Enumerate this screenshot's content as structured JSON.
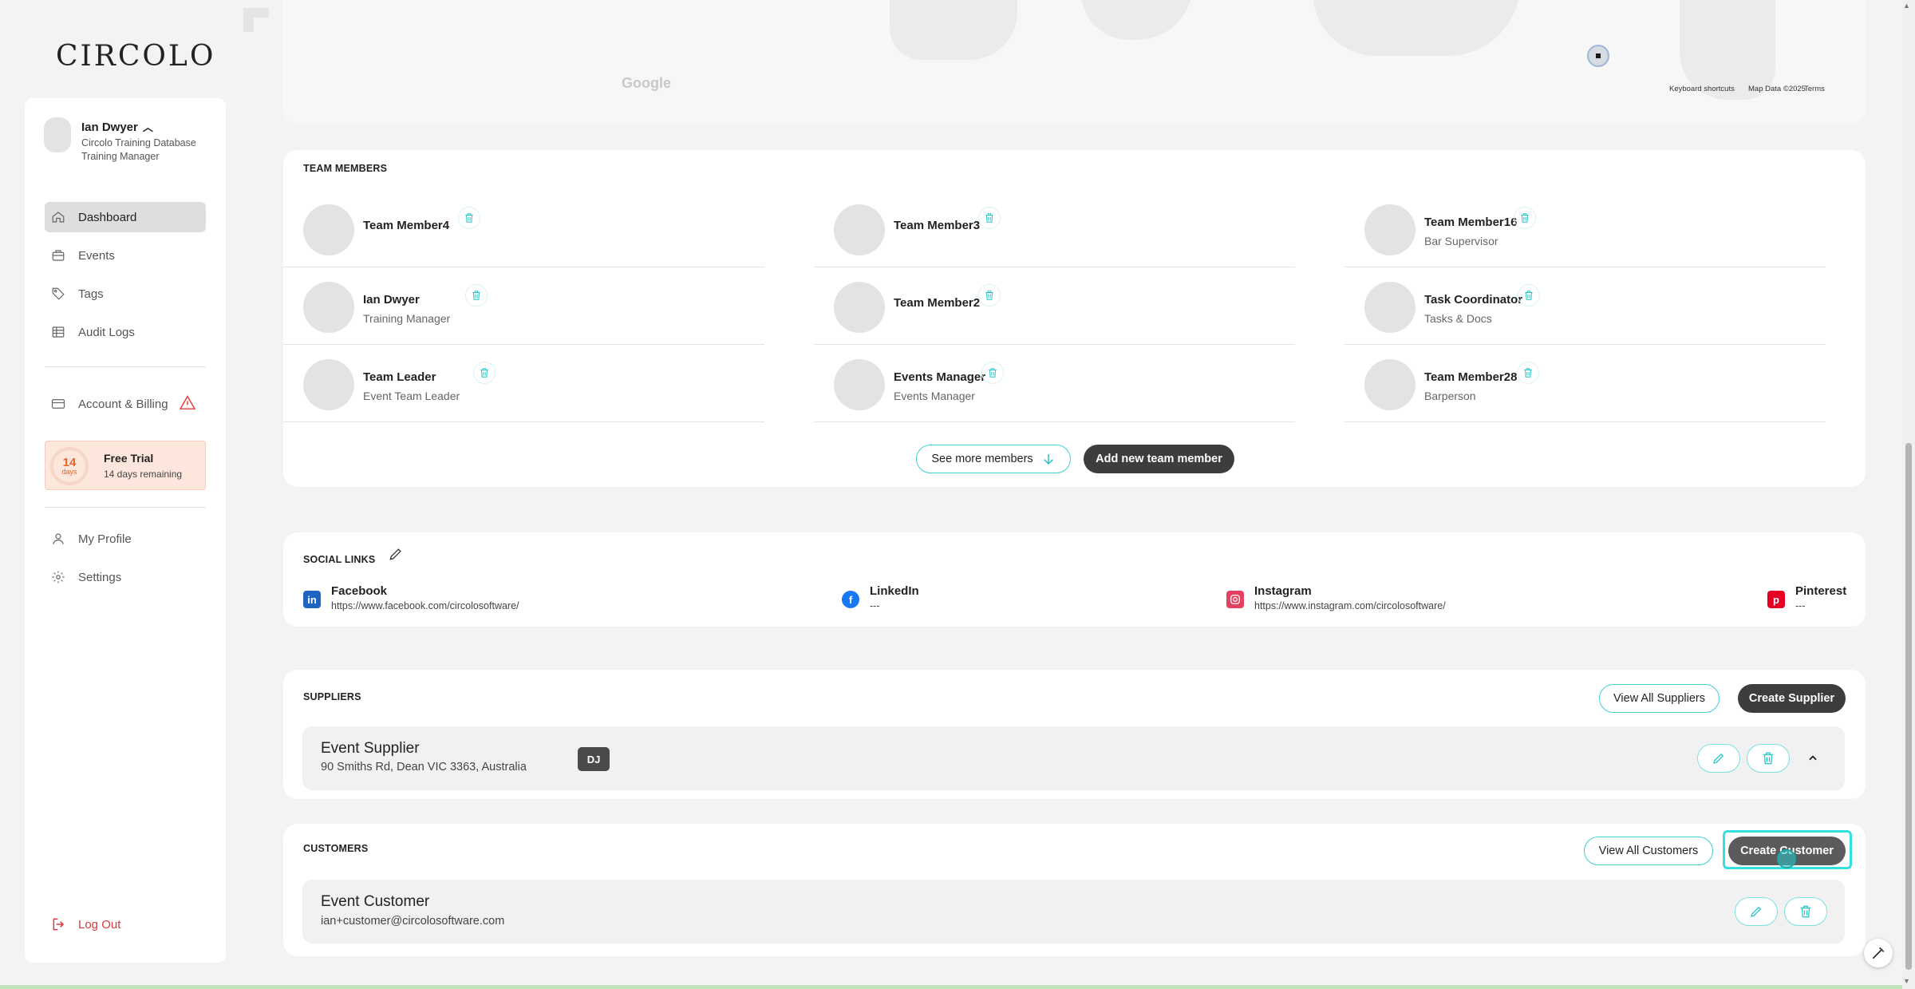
{
  "brand": {
    "logo": "CIRCOLO"
  },
  "user": {
    "name": "Ian Dwyer",
    "org": "Circolo Training Database",
    "role": "Training Manager"
  },
  "nav": {
    "dashboard": "Dashboard",
    "events": "Events",
    "tags": "Tags",
    "audit_logs": "Audit Logs",
    "account_billing": "Account & Billing",
    "my_profile": "My Profile",
    "settings": "Settings",
    "logout": "Log Out"
  },
  "trial": {
    "days": "14",
    "unit": "days",
    "title": "Free Trial",
    "remaining": "14 days remaining"
  },
  "map": {
    "google": "Google",
    "shortcuts": "Keyboard shortcuts",
    "map_data": "Map Data ©2025",
    "terms": "Terms"
  },
  "team": {
    "title": "TEAM MEMBERS",
    "members": [
      {
        "name": "Team Member4",
        "role": ""
      },
      {
        "name": "Team Member3",
        "role": ""
      },
      {
        "name": "Team Member16",
        "role": "Bar Supervisor"
      },
      {
        "name": "Ian Dwyer",
        "role": "Training Manager"
      },
      {
        "name": "Team Member2",
        "role": ""
      },
      {
        "name": "Task Coordinator",
        "role": "Tasks & Docs"
      },
      {
        "name": "Team Leader",
        "role": "Event Team Leader"
      },
      {
        "name": "Events Manager",
        "role": "Events Manager"
      },
      {
        "name": "Team Member28",
        "role": "Barperson"
      }
    ],
    "see_more": "See more members",
    "add_new": "Add new team member"
  },
  "social": {
    "title": "SOCIAL LINKS",
    "links": [
      {
        "name": "Facebook",
        "url": "https://www.facebook.com/circolosoftware/",
        "icon": "linkedin-icon"
      },
      {
        "name": "LinkedIn",
        "url": "---",
        "icon": "facebook-icon"
      },
      {
        "name": "Instagram",
        "url": "https://www.instagram.com/circolosoftware/",
        "icon": "instagram-icon"
      },
      {
        "name": "Pinterest",
        "url": "---",
        "icon": "pinterest-icon"
      }
    ]
  },
  "suppliers": {
    "title": "SUPPLIERS",
    "view_all": "View All Suppliers",
    "create": "Create Supplier",
    "item": {
      "name": "Event Supplier",
      "address": "90 Smiths Rd, Dean VIC 3363, Australia",
      "badge": "DJ"
    }
  },
  "customers": {
    "title": "CUSTOMERS",
    "view_all": "View All Customers",
    "create": "Create Customer",
    "item": {
      "name": "Event Customer",
      "email": "ian+customer@circolosoftware.com"
    }
  },
  "colors": {
    "accent": "#3fd0d0",
    "dark_button": "#3d3d3d",
    "trial_bg": "#fde6dc",
    "danger": "#d93a3a"
  }
}
